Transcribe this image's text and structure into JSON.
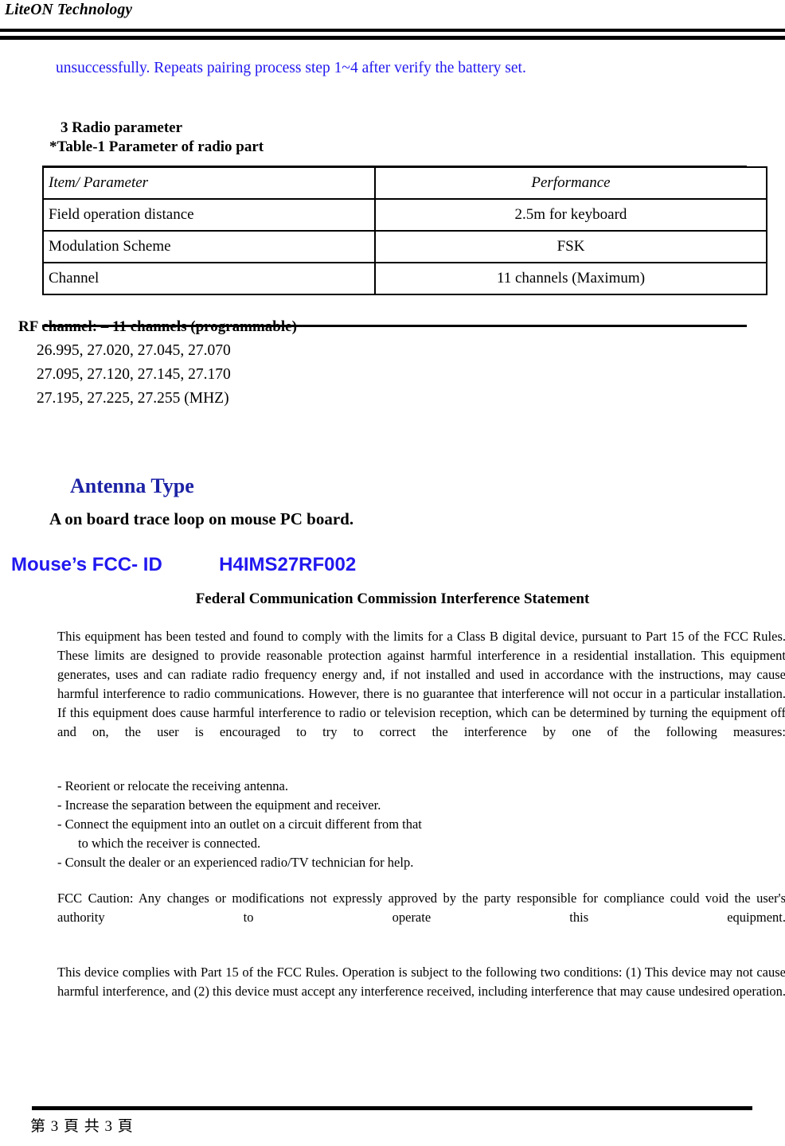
{
  "header": {
    "company": "LiteON Technology"
  },
  "intro": {
    "blue_line": "unsuccessfully. Repeats pairing process step 1~4 after verify the battery set."
  },
  "radio_section": {
    "heading": "3 Radio parameter",
    "table_caption": "*Table-1 Parameter of radio part"
  },
  "param_table": {
    "headers": [
      "Item/ Parameter",
      "Performance"
    ],
    "rows": [
      [
        "Field operation distance",
        "2.5m for keyboard"
      ],
      [
        "Modulation Scheme",
        "FSK"
      ],
      [
        "Channel",
        "11 channels (Maximum)"
      ]
    ]
  },
  "rf_channel": {
    "title": "RF channel: – 11 channels (programmable)",
    "frequencies": [
      "26.995, 27.020, 27.045, 27.070",
      "27.095, 27.120, 27.145, 27.170",
      "27.195, 27.225, 27.255 (MHZ)"
    ]
  },
  "antenna": {
    "title": "Antenna Type",
    "description": "A on board trace loop on mouse PC board."
  },
  "fcc_id": {
    "label": "Mouse’s FCC- ID",
    "value": "H4IMS27RF002"
  },
  "fcc_statement": {
    "heading": "Federal Communication Commission Interference Statement",
    "paragraph_1": "This equipment has been tested and found to comply with the limits for a Class B digital device, pursuant to Part 15 of the FCC Rules.    These limits are designed to provide reasonable protection against harmful interference in a residential installation.    This equipment generates, uses and can radiate radio frequency energy and, if not installed and used in accordance with the instructions, may cause harmful interference to radio communications.    However, there is no guarantee that interference will not occur in a particular installation.    If this equipment does cause harmful interference to radio or television reception, which can be determined by turning the equipment off and on, the user is encouraged to try to correct the interference by one of the following measures:",
    "measures": [
      "- Reorient or relocate the receiving antenna.",
      "- Increase the separation between the equipment and receiver.",
      "- Connect the equipment into an outlet on a circuit different from that",
      "to which the receiver is connected.",
      "- Consult the dealer or an experienced radio/TV technician for help."
    ],
    "caution": "FCC Caution: Any changes or modifications not expressly approved by the party responsible for compliance could void the user's authority to operate this equipment.",
    "compliance": "This device complies with Part 15 of the FCC Rules. Operation is subject to the following two conditions: (1) This device may not cause harmful interference, and (2) this device must accept any interference received, including interference that may cause undesired operation."
  },
  "footer": {
    "page_label": "第 3 頁 共 3 頁"
  },
  "colors": {
    "blue_text": "#2118ef",
    "navy_heading": "#1c22a5",
    "rule_black": "#000000"
  }
}
